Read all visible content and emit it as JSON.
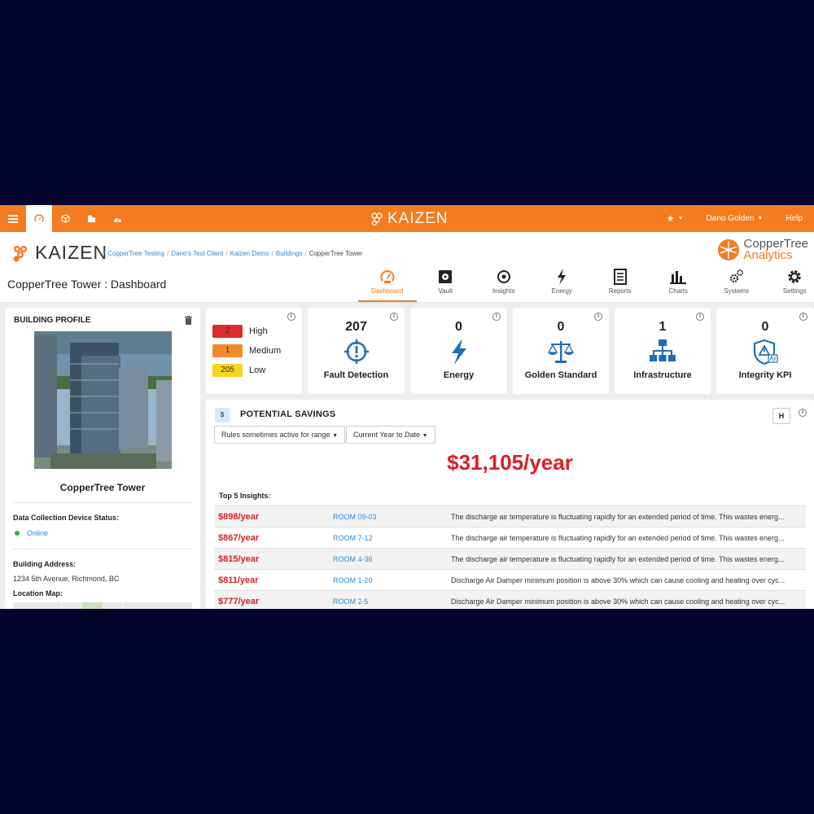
{
  "topbar": {
    "nav_icons": [
      "menu-icon",
      "dashboard-icon",
      "cube-icon",
      "building-icon",
      "gauge-icon"
    ],
    "logo_text": "KAIZEN",
    "user_name": "Dano Golden",
    "help_label": "Help"
  },
  "header": {
    "brand_text": "KAIZEN",
    "breadcrumb": [
      "CopperTree Testing",
      "Dano's Test Client",
      "Kaizen Demo",
      "Buildings"
    ],
    "breadcrumb_current": "CopperTree Tower",
    "title": "CopperTree Tower : Dashboard",
    "partner_logo": {
      "line1": "CopperTree",
      "line2": "Analytics"
    },
    "tabs": [
      {
        "label": "Dashboard",
        "icon": "gauge-icon"
      },
      {
        "label": "Vault",
        "icon": "vault-icon"
      },
      {
        "label": "Insights",
        "icon": "eye-icon"
      },
      {
        "label": "Energy",
        "icon": "bolt-icon"
      },
      {
        "label": "Reports",
        "icon": "document-icon"
      },
      {
        "label": "Charts",
        "icon": "bar-chart-icon"
      },
      {
        "label": "Systems",
        "icon": "cogs-icon"
      },
      {
        "label": "Settings",
        "icon": "gear-icon"
      }
    ]
  },
  "profile": {
    "title": "BUILDING PROFILE",
    "building_name": "CopperTree Tower",
    "device_status_label": "Data Collection Device Status:",
    "device_status": "Online",
    "address_label": "Building Address:",
    "address": "1234 5th Avenue, Richmond, BC",
    "map_label": "Location Map:"
  },
  "severity": {
    "rows": [
      {
        "count": "2",
        "label": "High",
        "color": "#e02b2b"
      },
      {
        "count": "1",
        "label": "Medium",
        "color": "#f18a2c"
      },
      {
        "count": "205",
        "label": "Low",
        "color": "#f7d51d"
      }
    ]
  },
  "metrics": [
    {
      "value": "207",
      "label": "Fault Detection",
      "icon": "fault-target-icon"
    },
    {
      "value": "0",
      "label": "Energy",
      "icon": "bolt-icon"
    },
    {
      "value": "0",
      "label": "Golden Standard",
      "icon": "scale-icon"
    },
    {
      "value": "1",
      "label": "Infrastructure",
      "icon": "hierarchy-icon"
    },
    {
      "value": "0",
      "label": "Integrity KPI",
      "icon": "shield-alert-icon"
    }
  ],
  "savings": {
    "icon_text": "$",
    "title": "POTENTIAL SAVINGS",
    "button_text": "H",
    "filter_rules": "Rules sometimes active for range",
    "filter_period": "Current Year to Date",
    "total": "$31,105/year",
    "top_label": "Top 5 Insights:",
    "insights": [
      {
        "amount": "$898/year",
        "room": "ROOM 09-03",
        "desc": "The discharge air temperature is fluctuating rapidly for an extended period of time. This wastes energ..."
      },
      {
        "amount": "$867/year",
        "room": "ROOM 7-12",
        "desc": "The discharge air temperature is fluctuating rapidly for an extended period of time. This wastes energ..."
      },
      {
        "amount": "$815/year",
        "room": "ROOM 4-36",
        "desc": "The discharge air temperature is fluctuating rapidly for an extended period of time. This wastes energ..."
      },
      {
        "amount": "$811/year",
        "room": "ROOM 1-20",
        "desc": "Discharge Air Damper minimum position is above 30% which can cause cooling and heating over cyc..."
      },
      {
        "amount": "$777/year",
        "room": "ROOM 2-5",
        "desc": "Discharge Air Damper minimum position is above 30% which can cause cooling and heating over cyc..."
      }
    ]
  },
  "colors": {
    "brand_orange": "#f47b20",
    "accent_blue": "#1f6fb5",
    "savings_red": "#d92027",
    "page_bg": "#03052c"
  }
}
